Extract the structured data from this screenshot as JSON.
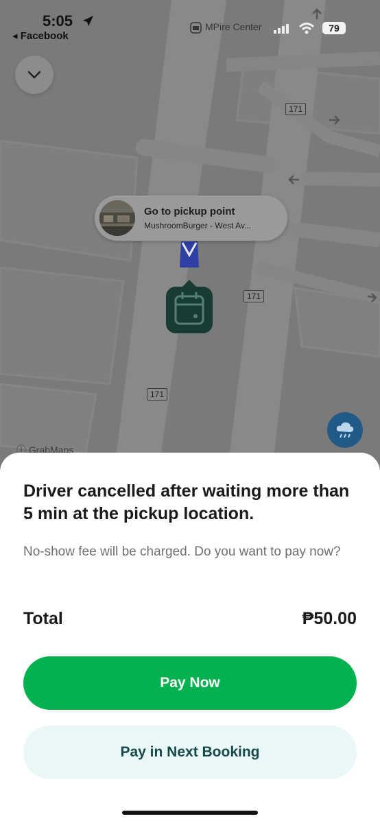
{
  "status_bar": {
    "time": "5:05",
    "back_app": "Facebook",
    "carrier": "MPire Center",
    "battery": "79"
  },
  "map": {
    "pickup": {
      "title": "Go to pickup point",
      "subtitle": "MushroomBurger - West Av..."
    },
    "road_labels": [
      "171",
      "171",
      "171"
    ],
    "attribution": "GrabMaps",
    "icons": [
      "chevron-down-icon",
      "car-icon",
      "calendar-icon",
      "rain-cloud-icon",
      "location-arrow-icon",
      "wifi-icon",
      "signal-icon",
      "battery-icon"
    ]
  },
  "sheet": {
    "headline": "Driver cancelled after waiting more than 5 min at the pickup location.",
    "subtext": "No-show fee will be charged. Do you want to pay now?",
    "total_label": "Total",
    "total_value": "₱50.00",
    "primary_button": "Pay Now",
    "secondary_button": "Pay in Next Booking"
  },
  "colors": {
    "primary": "#03b14e",
    "secondary_bg": "#eaf6f7",
    "secondary_text": "#134a49",
    "calendar_marker": "#183b33",
    "weather_button": "#215a86"
  }
}
